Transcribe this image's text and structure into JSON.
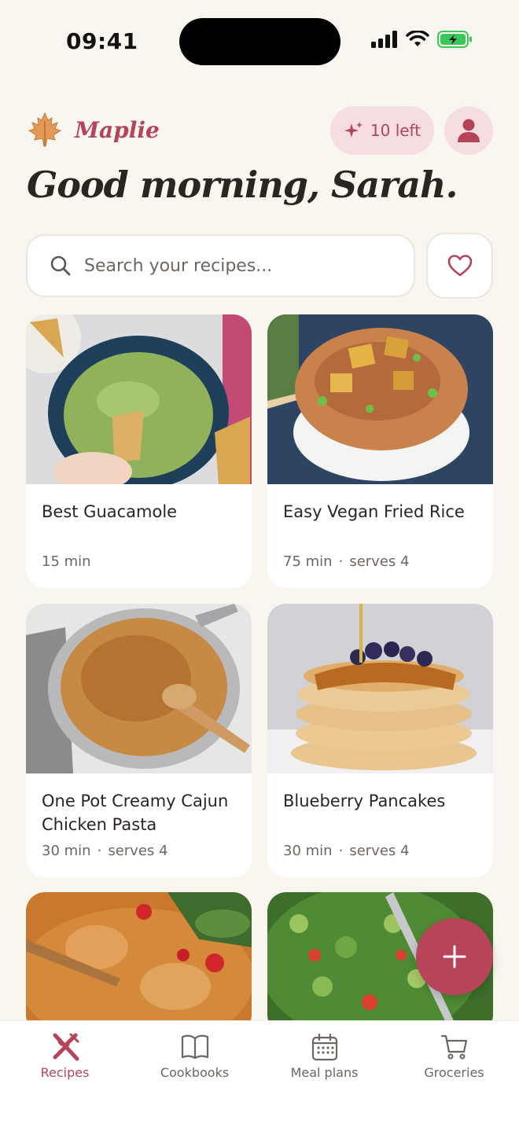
{
  "status_bar": {
    "time": "09:41"
  },
  "header": {
    "brand_name": "Maplie",
    "credits_label": "10 left",
    "greeting": "Good morning, Sarah."
  },
  "search": {
    "placeholder": "Search your recipes..."
  },
  "recipes": [
    {
      "title": "Best Guacamole",
      "time": "15 min",
      "serves": ""
    },
    {
      "title": "Easy Vegan Fried Rice",
      "time": "75 min",
      "serves": "serves 4"
    },
    {
      "title": "One Pot Creamy Cajun Chicken Pasta",
      "time": "30 min",
      "serves": "serves 4"
    },
    {
      "title": "Blueberry Pancakes",
      "time": "30 min",
      "serves": "serves 4"
    }
  ],
  "nav": [
    {
      "label": "Recipes",
      "icon": "fork-knife-icon",
      "active": true
    },
    {
      "label": "Cookbooks",
      "icon": "book-icon",
      "active": false
    },
    {
      "label": "Meal plans",
      "icon": "calendar-icon",
      "active": false
    },
    {
      "label": "Groceries",
      "icon": "cart-icon",
      "active": false
    }
  ],
  "colors": {
    "accent": "#b5445b",
    "background": "#f9f5ef",
    "pill": "#f5dde0"
  }
}
